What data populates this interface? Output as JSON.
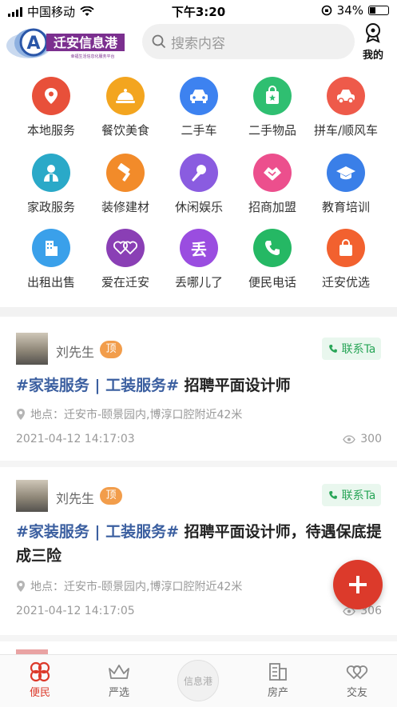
{
  "status_bar": {
    "carrier": "中国移动",
    "time": "下午3:20",
    "battery": "34%"
  },
  "header": {
    "logo_text": "迁安信息港",
    "logo_subtext": "幸福生活信息化服务平台",
    "search_placeholder": "搜索内容",
    "me_label": "我的"
  },
  "categories": [
    {
      "label": "本地服务",
      "icon": "location-icon",
      "color": "#e8503a"
    },
    {
      "label": "餐饮美食",
      "icon": "dish-icon",
      "color": "#f3a51f"
    },
    {
      "label": "二手车",
      "icon": "car-icon",
      "color": "#3d82f0"
    },
    {
      "label": "二手物品",
      "icon": "bag-icon",
      "color": "#2fbf71"
    },
    {
      "label": "拼车/顺风车",
      "icon": "carpool-icon",
      "color": "#ee5a4a"
    },
    {
      "label": "家政服务",
      "icon": "worker-icon",
      "color": "#2aa9c8"
    },
    {
      "label": "装修建材",
      "icon": "brush-icon",
      "color": "#f28b2a"
    },
    {
      "label": "休闲娱乐",
      "icon": "microphone-icon",
      "color": "#8a5ce0"
    },
    {
      "label": "招商加盟",
      "icon": "handshake-icon",
      "color": "#ec4f8d"
    },
    {
      "label": "教育培训",
      "icon": "graduation-cap-icon",
      "color": "#3a7fe8"
    },
    {
      "label": "出租出售",
      "icon": "building-icon",
      "color": "#3aa0ea"
    },
    {
      "label": "爱在迁安",
      "icon": "hearts-icon",
      "color": "#8a3fb5"
    },
    {
      "label": "丢哪儿了",
      "icon": "lost-icon",
      "color": "#9a4de0",
      "glyph": "丢"
    },
    {
      "label": "便民电话",
      "icon": "phone-icon",
      "color": "#25b864"
    },
    {
      "label": "迁安优选",
      "icon": "shopping-bag-icon",
      "color": "#f2612f"
    }
  ],
  "posts": [
    {
      "user": "刘先生",
      "badge": "顶",
      "contact": "联系Ta",
      "tags": "#家装服务 | 工装服务#",
      "title": "招聘平面设计师",
      "address": "地点：迁安市-颐景园内,博淳口腔附近42米",
      "date": "2021-04-12 14:17:03",
      "views": "300"
    },
    {
      "user": "刘先生",
      "badge": "顶",
      "contact": "联系Ta",
      "tags": "#家装服务 | 工装服务#",
      "title": "招聘平面设计师，待遇保底提成三险",
      "address": "地点：迁安市-颐景园内,博淳口腔附近42米",
      "date": "2021-04-12 14:17:05",
      "views": "306"
    }
  ],
  "tabbar": {
    "tabs": [
      {
        "label": "便民",
        "icon": "community-icon",
        "active": true
      },
      {
        "label": "严选",
        "icon": "crown-icon",
        "active": false
      },
      {
        "label": "房产",
        "icon": "building-icon",
        "active": false
      },
      {
        "label": "交友",
        "icon": "hearts-icon",
        "active": false
      }
    ],
    "center_label": "信息港"
  },
  "colors": {
    "accent": "#dc3a2b",
    "tag_blue": "#3b5fa0",
    "contact_green": "#28a557",
    "badge_orange": "#f29d4b"
  }
}
